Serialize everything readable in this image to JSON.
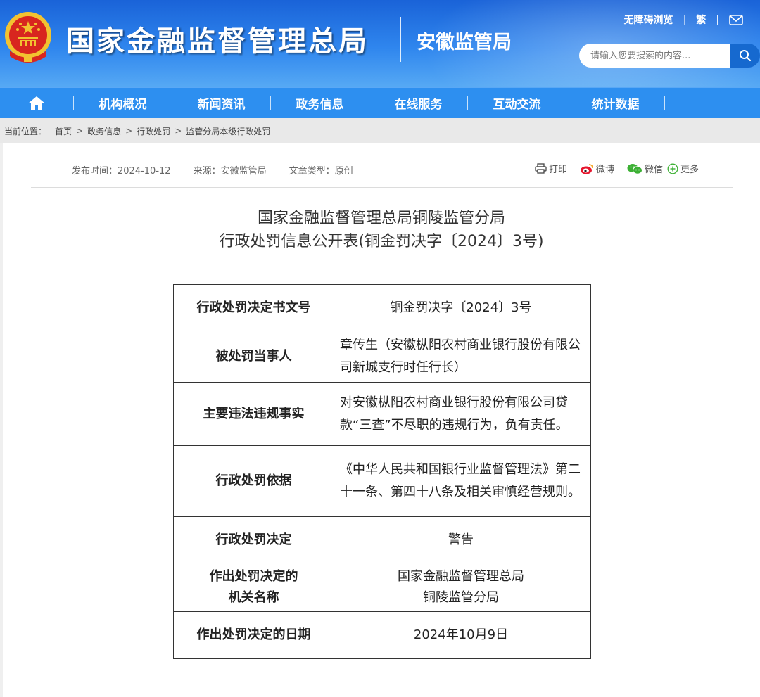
{
  "header": {
    "site_title": "国家金融监督管理总局",
    "sub_title": "安徽监管局",
    "links": {
      "accessible": "无障碍浏览",
      "traditional": "繁"
    },
    "search_placeholder": "请输入您要搜索的内容..."
  },
  "nav": {
    "items": [
      "机构概况",
      "新闻资讯",
      "政务信息",
      "在线服务",
      "互动交流",
      "统计数据"
    ]
  },
  "breadcrumb": {
    "prefix": "当前位置：",
    "items": [
      "首页",
      "政务信息",
      "行政处罚",
      "监管分局本级行政处罚"
    ],
    "separator": ">"
  },
  "article": {
    "meta": {
      "publish": "发布时间：2024-10-12",
      "source": "来源：安徽监管局",
      "type": "文章类型：原创"
    },
    "share": {
      "print": "打印",
      "weibo": "微博",
      "wechat": "微信",
      "more": "更多"
    },
    "title_line1": "国家金融监督管理总局铜陵监管分局",
    "title_line2": "行政处罚信息公开表(铜金罚决字〔2024〕3号)"
  },
  "table": [
    {
      "key": "行政处罚决定书文号",
      "value": "铜金罚决字〔2024〕3号"
    },
    {
      "key": "被处罚当事人",
      "value": "章传生（安徽枞阳农村商业银行股份有限公司新城支行时任行长）"
    },
    {
      "key": "主要违法违规事实",
      "value": "对安徽枞阳农村商业银行股份有限公司贷款“三查”不尽职的违规行为，负有责任。"
    },
    {
      "key": "行政处罚依据",
      "value": "《中华人民共和国银行业监督管理法》第二十一条、第四十八条及相关审慎经营规则。"
    },
    {
      "key": "行政处罚决定",
      "value": "警告"
    },
    {
      "key_line1": "作出处罚决定的",
      "key_line2": "机关名称",
      "value_line1": "国家金融监督管理总局",
      "value_line2": "铜陵监管分局"
    },
    {
      "key": "作出处罚决定的日期",
      "value": "2024年10月9日"
    }
  ],
  "colors": {
    "header_blue": "#2f86ee",
    "nav_blue": "#2d8ff0",
    "emblem_red": "#d8261f",
    "emblem_gold": "#f2c230"
  }
}
